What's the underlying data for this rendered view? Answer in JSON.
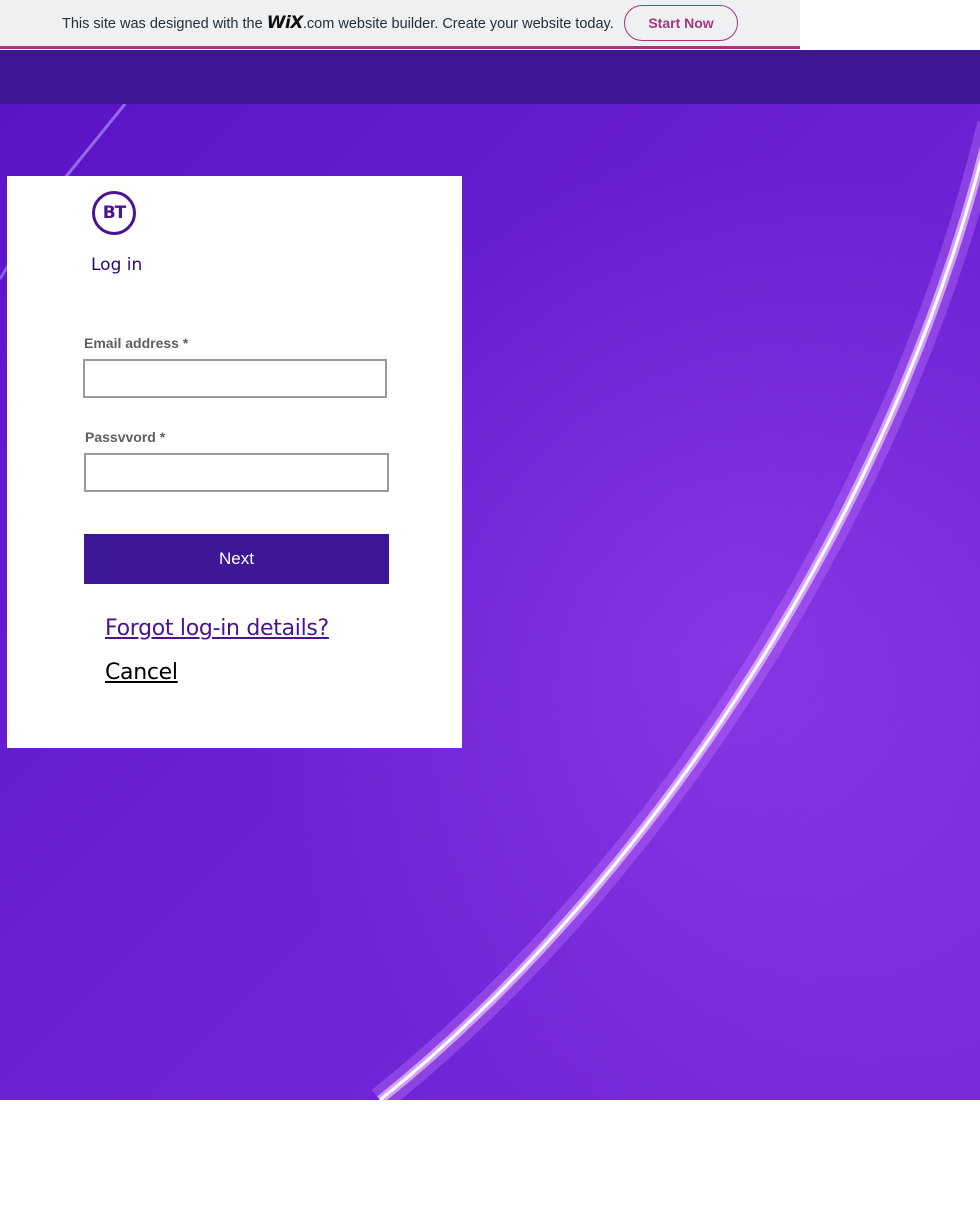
{
  "wix_banner": {
    "text_before": "This site was designed with the ",
    "logo": "WiX",
    "text_after": ".com website builder. Create your website today.",
    "button": "Start Now"
  },
  "login": {
    "logo": "BT",
    "title": "Log in",
    "email_label": "Email address *",
    "email_value": "",
    "password_label": "Passvvord *",
    "password_value": "",
    "next_button": "Next",
    "forgot_link": "Forgot log-in details?",
    "cancel_link": "Cancel"
  },
  "colors": {
    "brand_purple": "#3d1796",
    "wix_accent": "#a8347f"
  }
}
